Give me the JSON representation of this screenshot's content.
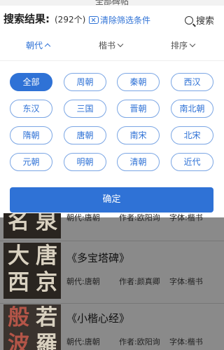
{
  "window": {
    "title": "全部碑帖"
  },
  "search": {
    "label": "搜索结果:",
    "count": "(292个)",
    "clear_label": "清除筛选条件",
    "search_label": "搜索"
  },
  "sort_bar": {
    "items": [
      {
        "label": "朝代",
        "state": "open"
      },
      {
        "label": "楷书",
        "state": "closed"
      },
      {
        "label": "排序",
        "state": "closed"
      }
    ]
  },
  "dynasty_filter": {
    "selected": "全部",
    "options": [
      "全部",
      "周朝",
      "秦朝",
      "西汉",
      "东汉",
      "三国",
      "晋朝",
      "南北朝",
      "隋朝",
      "唐朝",
      "南宋",
      "北宋",
      "元朝",
      "明朝",
      "清朝",
      "近代"
    ]
  },
  "confirm_label": "确定",
  "colors": {
    "accent": "#2f72d6",
    "overlay": "#8a8a8a"
  },
  "results": [
    {
      "title": "",
      "dynasty": "朝代:唐朝",
      "author": "作者:欧阳询",
      "script": "字体:楷书",
      "thumb_chars": [
        "名",
        "泉"
      ]
    },
    {
      "title": "《多宝塔碑》",
      "dynasty": "朝代:唐朝",
      "author": "作者:颜真卿",
      "script": "字体:楷书",
      "thumb_chars": [
        "大",
        "唐",
        "西",
        "京"
      ]
    },
    {
      "title": "《小楷心经》",
      "dynasty": "朝代:唐朝",
      "author": "作者:欧阳询",
      "script": "字体:楷书",
      "thumb_chars": [
        "般",
        "若",
        "波",
        "羅"
      ]
    }
  ]
}
